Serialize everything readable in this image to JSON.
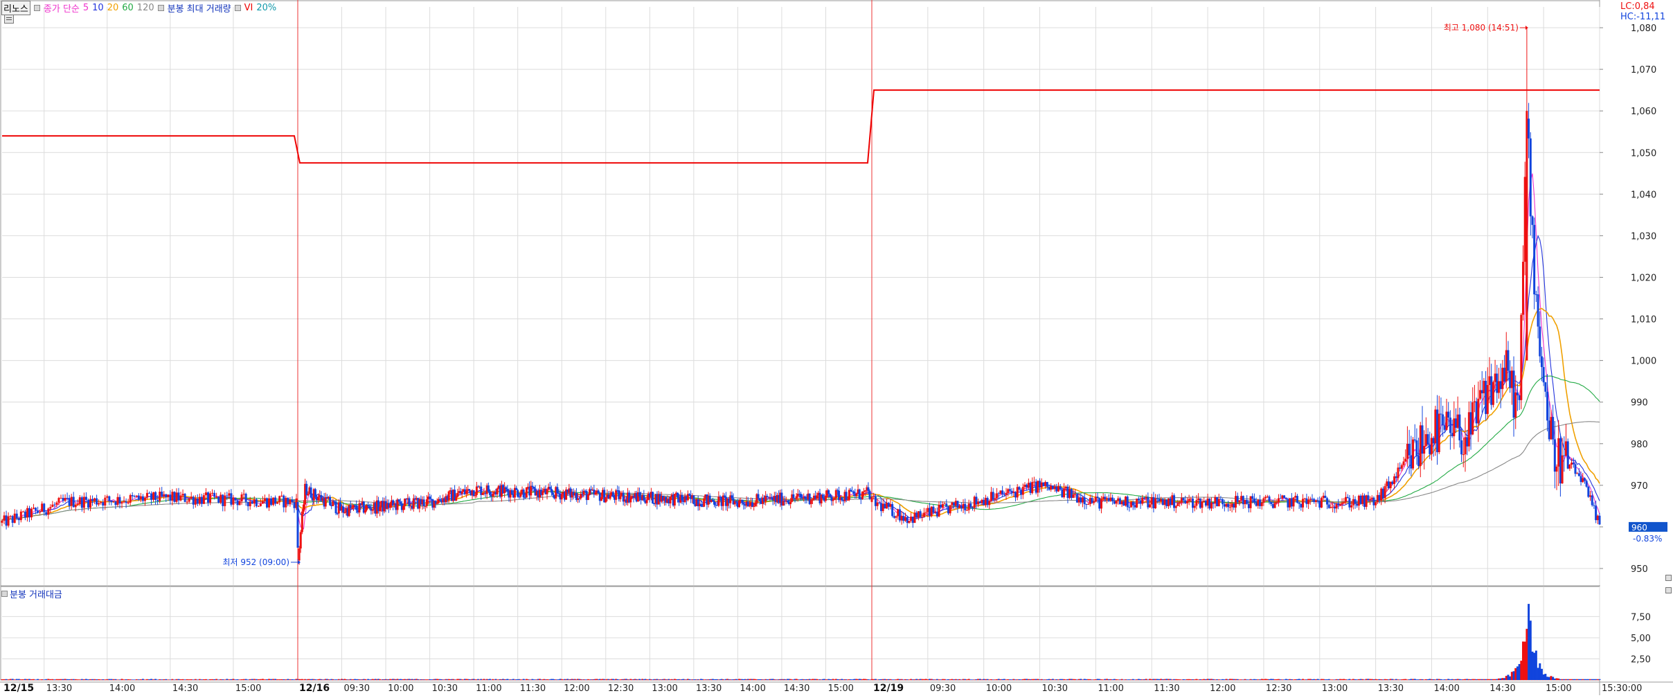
{
  "legend": {
    "stock_name": "리노스",
    "ma_label": "종가 단순",
    "ma_periods": [
      "5",
      "10",
      "20",
      "60",
      "120"
    ],
    "volume_max_label": "분봉 최대 거래량",
    "vi_label": "VI",
    "vi_pct": "20%"
  },
  "lc_label": "LC:0,84",
  "hc_label": "HC:-11,11",
  "colors": {
    "up": "#ee1111",
    "down": "#1144dd",
    "ma5": "#ee33cc",
    "ma10": "#2233dd",
    "ma20": "#f0a000",
    "ma60": "#22aa44",
    "ma120": "#888888",
    "vi": "#ee0000",
    "grid": "#dcdcdc"
  },
  "price_axis": {
    "min": 946,
    "max": 1085,
    "ticks": [
      950,
      960,
      970,
      980,
      990,
      1000,
      1010,
      1020,
      1030,
      1040,
      1050,
      1060,
      1070,
      1080
    ],
    "tick_labels": [
      "950",
      "960",
      "970",
      "980",
      "990",
      "1,000",
      "1,010",
      "1,020",
      "1,030",
      "1,040",
      "1,050",
      "1,060",
      "1,070",
      "1,080"
    ]
  },
  "volume_axis": {
    "max": 9.5,
    "ticks": [
      2.5,
      5.0,
      7.5
    ],
    "tick_labels": [
      "2,50",
      "5,00",
      "7,50"
    ],
    "legend": "분봉 거래대금"
  },
  "current_price": {
    "value": 960,
    "label": "960",
    "change": "-0.83%"
  },
  "annotations": {
    "high": {
      "label": "최고 1,080 (14:51)",
      "value": 1080
    },
    "low": {
      "label": "최저 952 (09:00)",
      "value": 952
    }
  },
  "day_labels": [
    "12/15",
    "12/16",
    "12/19"
  ],
  "time_ticks": [
    {
      "day": 0,
      "label": "13:30"
    },
    {
      "day": 0,
      "label": "14:00"
    },
    {
      "day": 0,
      "label": "14:30"
    },
    {
      "day": 0,
      "label": "15:00"
    },
    {
      "day": 1,
      "label": "09:30"
    },
    {
      "day": 1,
      "label": "10:00"
    },
    {
      "day": 1,
      "label": "10:30"
    },
    {
      "day": 1,
      "label": "11:00"
    },
    {
      "day": 1,
      "label": "11:30"
    },
    {
      "day": 1,
      "label": "12:00"
    },
    {
      "day": 1,
      "label": "12:30"
    },
    {
      "day": 1,
      "label": "13:00"
    },
    {
      "day": 1,
      "label": "13:30"
    },
    {
      "day": 1,
      "label": "14:00"
    },
    {
      "day": 1,
      "label": "14:30"
    },
    {
      "day": 1,
      "label": "15:00"
    },
    {
      "day": 2,
      "label": "09:30"
    },
    {
      "day": 2,
      "label": "10:00"
    },
    {
      "day": 2,
      "label": "10:30"
    },
    {
      "day": 2,
      "label": "11:00"
    },
    {
      "day": 2,
      "label": "11:30"
    },
    {
      "day": 2,
      "label": "12:00"
    },
    {
      "day": 2,
      "label": "12:30"
    },
    {
      "day": 2,
      "label": "13:00"
    },
    {
      "day": 2,
      "label": "13:30"
    },
    {
      "day": 2,
      "label": "14:00"
    },
    {
      "day": 2,
      "label": "14:30"
    },
    {
      "day": 2,
      "label": "15:00"
    },
    {
      "day": 2,
      "label": "15:30:00"
    }
  ],
  "chart_data": {
    "type": "candlestick",
    "title": "리노스",
    "x_unit": "1-minute bars, 3 trading sessions",
    "sessions": [
      {
        "date": "12/15",
        "start": "13:10",
        "end": "15:30",
        "vi_level": 1054
      },
      {
        "date": "12/16",
        "start": "09:00",
        "end": "15:30",
        "vi_level": 1047.5
      },
      {
        "date": "12/19",
        "start": "09:00",
        "end": "15:30",
        "vi_level": 1065
      }
    ],
    "price_path_keypoints": [
      {
        "day": 0,
        "time": "13:10",
        "price": 961
      },
      {
        "day": 0,
        "time": "13:40",
        "price": 966
      },
      {
        "day": 0,
        "time": "14:30",
        "price": 967
      },
      {
        "day": 0,
        "time": "15:30",
        "price": 966
      },
      {
        "day": 1,
        "time": "09:00",
        "price": 952
      },
      {
        "day": 1,
        "time": "09:05",
        "price": 969
      },
      {
        "day": 1,
        "time": "09:30",
        "price": 964
      },
      {
        "day": 1,
        "time": "10:30",
        "price": 966
      },
      {
        "day": 1,
        "time": "11:00",
        "price": 969
      },
      {
        "day": 1,
        "time": "12:00",
        "price": 968
      },
      {
        "day": 1,
        "time": "14:00",
        "price": 966
      },
      {
        "day": 1,
        "time": "15:30",
        "price": 968
      },
      {
        "day": 2,
        "time": "09:00",
        "price": 966
      },
      {
        "day": 2,
        "time": "09:20",
        "price": 962
      },
      {
        "day": 2,
        "time": "10:30",
        "price": 970
      },
      {
        "day": 2,
        "time": "11:00",
        "price": 966
      },
      {
        "day": 2,
        "time": "12:00",
        "price": 966
      },
      {
        "day": 2,
        "time": "13:30",
        "price": 966
      },
      {
        "day": 2,
        "time": "14:00",
        "price": 983
      },
      {
        "day": 2,
        "time": "14:20",
        "price": 982
      },
      {
        "day": 2,
        "time": "14:30",
        "price": 993
      },
      {
        "day": 2,
        "time": "14:40",
        "price": 997
      },
      {
        "day": 2,
        "time": "14:47",
        "price": 988
      },
      {
        "day": 2,
        "time": "14:51",
        "price": 1060
      },
      {
        "day": 2,
        "time": "14:55",
        "price": 1020
      },
      {
        "day": 2,
        "time": "15:00",
        "price": 995
      },
      {
        "day": 2,
        "time": "15:05",
        "price": 978
      },
      {
        "day": 2,
        "time": "15:20",
        "price": 972
      },
      {
        "day": 2,
        "time": "15:30",
        "price": 960
      }
    ],
    "volume_peak": {
      "day": 2,
      "time": "14:52",
      "value": 9.0
    },
    "high": {
      "price": 1080,
      "time": "14:51"
    },
    "low": {
      "price": 952,
      "time": "09:00"
    },
    "moving_averages": [
      "5",
      "10",
      "20",
      "60",
      "120"
    ]
  }
}
